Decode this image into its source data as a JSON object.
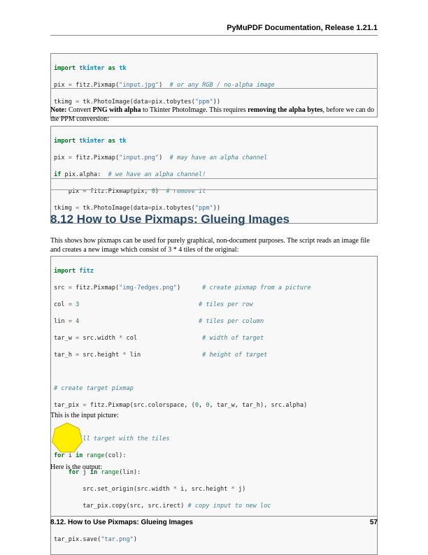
{
  "header": {
    "title": "PyMuPDF Documentation, Release 1.21.1"
  },
  "code1": {
    "l1_kw1": "import",
    "l1_mod": "tkinter",
    "l1_kw2": "as",
    "l1_alias": "tk",
    "l2_a": "pix ",
    "l2_eq": "=",
    "l2_b": " fitz.Pixmap(",
    "l2_str": "\"input.jpg\"",
    "l2_c": ")  ",
    "l2_cm": "# or any RGB / no-alpha image",
    "l3_a": "tkimg ",
    "l3_eq": "=",
    "l3_b": " tk.PhotoImage(data",
    "l3_eq2": "=",
    "l3_c": "pix.tobytes(",
    "l3_str": "\"ppm\"",
    "l3_d": "))"
  },
  "note": {
    "label": "Note:",
    "t1": " Convert ",
    "b1": "PNG with alpha",
    "t2": " to Tkinter PhotoImage. This requires ",
    "b2": "removing the alpha bytes",
    "t3": ", before we can do the PPM conversion:"
  },
  "code2": {
    "l1_kw1": "import",
    "l1_mod": "tkinter",
    "l1_kw2": "as",
    "l1_alias": "tk",
    "l2_a": "pix ",
    "l2_eq": "=",
    "l2_b": " fitz.Pixmap(",
    "l2_str": "\"input.png\"",
    "l2_c": ")  ",
    "l2_cm": "# may have an alpha channel",
    "l3_kw": "if",
    "l3_a": " pix.alpha:  ",
    "l3_cm": "# we have an alpha channel!",
    "l4_a": "    pix ",
    "l4_eq": "=",
    "l4_b": " fitz.Pixmap(pix, ",
    "l4_num": "0",
    "l4_c": ")  ",
    "l4_cm": "# remove it",
    "l5_a": "tkimg ",
    "l5_eq": "=",
    "l5_b": " tk.PhotoImage(data",
    "l5_eq2": "=",
    "l5_c": "pix.tobytes(",
    "l5_str": "\"ppm\"",
    "l5_d": "))"
  },
  "section": {
    "title": "8.12  How to Use Pixmaps: Glueing Images"
  },
  "intro": "This shows how pixmaps can be used for purely graphical, non-document purposes. The script reads an image file and creates a new image which consist of 3 * 4 tiles of the original:",
  "code3": {
    "l1_kw": "import",
    "l1_mod": "fitz",
    "l2_a": "src ",
    "l2_eq": "=",
    "l2_b": " fitz.Pixmap(",
    "l2_str": "\"img-7edges.png\"",
    "l2_c": ")      ",
    "l2_cm": "# create pixmap from a picture",
    "l3_a": "col ",
    "l3_eq": "=",
    "l3_sp": " ",
    "l3_num": "3",
    "l3_pad": "                                 ",
    "l3_cm": "# tiles per row",
    "l4_a": "lin ",
    "l4_eq": "=",
    "l4_sp": " ",
    "l4_num": "4",
    "l4_pad": "                                 ",
    "l4_cm": "# tiles per column",
    "l5_a": "tar_w ",
    "l5_eq": "=",
    "l5_b": " src.width ",
    "l5_op": "*",
    "l5_c": " col                  ",
    "l5_cm": "# width of target",
    "l6_a": "tar_h ",
    "l6_eq": "=",
    "l6_b": " src.height ",
    "l6_op": "*",
    "l6_c": " lin                 ",
    "l6_cm": "# height of target",
    "l8_cm": "# create target pixmap",
    "l9_a": "tar_pix ",
    "l9_eq": "=",
    "l9_b": " fitz.Pixmap(src.colorspace, (",
    "l9_n1": "0",
    "l9_c": ", ",
    "l9_n2": "0",
    "l9_d": ", tar_w, tar_h), src.alpha)",
    "l11_cm": "# now fill target with the tiles",
    "l12_kw": "for",
    "l12_a": " i ",
    "l12_in": "in",
    "l12_sp": " ",
    "l12_nb": "range",
    "l12_b": "(col):",
    "l13_sp": "    ",
    "l13_kw": "for",
    "l13_a": " j ",
    "l13_in": "in",
    "l13_sp2": " ",
    "l13_nb": "range",
    "l13_b": "(lin):",
    "l14_a": "        src.set_origin(src.width ",
    "l14_op1": "*",
    "l14_b": " i, src.height ",
    "l14_op2": "*",
    "l14_c": " j)",
    "l15_a": "        tar_pix.copy(src, src.irect) ",
    "l15_cm": "# copy input to new loc",
    "l17_a": "tar_pix.save(",
    "l17_str": "\"tar.png\"",
    "l17_b": ")"
  },
  "input_caption": "This is the input picture:",
  "output_caption": "Here is the output:",
  "colors": {
    "heptagon_fill": "#ffee00",
    "heptagon_stroke": "#c8b400",
    "title_blue": "#2a4a6a"
  },
  "footer": {
    "section": "8.12. How to Use Pixmaps: Glueing Images",
    "page": "57"
  }
}
